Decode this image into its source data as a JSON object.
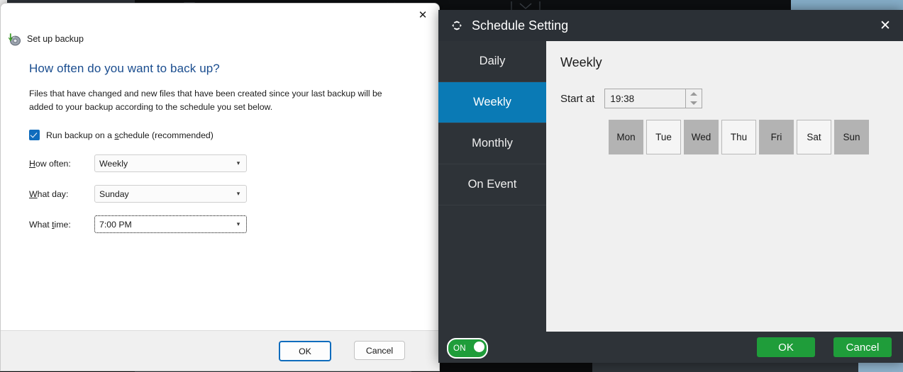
{
  "background": {
    "toolbar_icons": [
      "list-icon",
      "clipboard-icon",
      "wrench-icon",
      "chevron-down-icon"
    ]
  },
  "wizard": {
    "close_label": "✕",
    "app_icon": "backup-disk-icon",
    "app_label": "Set up backup",
    "heading": "How often do you want to back up?",
    "description": "Files that have changed and new files that have been created since your last backup will be added to your backup according to the schedule you set below.",
    "checkbox": {
      "checked": true,
      "label_before": "Run backup on a ",
      "label_accel": "s",
      "label_after": "chedule (recommended)"
    },
    "fields": [
      {
        "label_accel": "H",
        "label_rest": "ow often:",
        "value": "Weekly",
        "focused": false,
        "name": "how-often"
      },
      {
        "label_accel": "W",
        "label_rest": "hat day:",
        "value": "Sunday",
        "focused": false,
        "name": "what-day"
      },
      {
        "label_pre": "What ",
        "label_accel": "t",
        "label_rest": "ime:",
        "value": "7:00 PM",
        "focused": true,
        "name": "what-time"
      }
    ],
    "footer": {
      "ok_label": "OK",
      "cancel_label": "Cancel"
    }
  },
  "schedule": {
    "title": "Schedule Setting",
    "title_icon": "sync-arrows-icon",
    "close_label": "✕",
    "nav": [
      {
        "label": "Daily",
        "active": false
      },
      {
        "label": "Weekly",
        "active": true
      },
      {
        "label": "Monthly",
        "active": false
      },
      {
        "label": "On Event",
        "active": false
      }
    ],
    "content": {
      "title": "Weekly",
      "start_at_label": "Start at",
      "start_at_value": "19:38",
      "spinner_up": "spinner-up-icon",
      "spinner_down": "spinner-down-icon",
      "days": [
        {
          "label": "Mon",
          "selected": true
        },
        {
          "label": "Tue",
          "selected": false
        },
        {
          "label": "Wed",
          "selected": true
        },
        {
          "label": "Thu",
          "selected": false
        },
        {
          "label": "Fri",
          "selected": true
        },
        {
          "label": "Sat",
          "selected": false
        },
        {
          "label": "Sun",
          "selected": true
        }
      ]
    },
    "footer": {
      "toggle_label": "ON",
      "toggle_on": true,
      "ok_label": "OK",
      "cancel_label": "Cancel"
    },
    "colors": {
      "accent_blue": "#0a7ab5",
      "green": "#1f9d3a",
      "window_dark": "#2e3338"
    }
  }
}
